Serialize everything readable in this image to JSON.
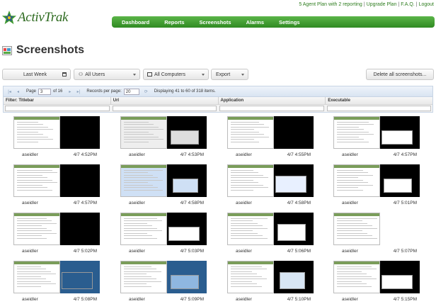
{
  "top_links": {
    "agent_plan": "5 Agent Plan with 2 reporting",
    "upgrade": "Upgrade Plan",
    "faq": "F.A.Q.",
    "logout": "Logout"
  },
  "brand": {
    "name": "ActivTrak",
    "accent": "#3f9b2e",
    "text_color": "#2d6a1f"
  },
  "nav": [
    "Dashboard",
    "Reports",
    "Screenshots",
    "Alarms",
    "Settings"
  ],
  "page": {
    "title": "Screenshots"
  },
  "toolbar": {
    "period": "Last Week",
    "users": "All Users",
    "computers": "All Computers",
    "export": "Export",
    "delete_all": "Delete all screenshots..."
  },
  "pager": {
    "page_label": "Page",
    "page": "3",
    "of": "of 16",
    "records_label": "Records per page:",
    "records": "20",
    "displaying": "Displaying 41 to 60 of 318 items."
  },
  "filters": [
    "Filter: Titlebar",
    "Url",
    "Application",
    "Executable"
  ],
  "screenshots": [
    {
      "user": "aseidler",
      "time": "4/7 4:52PM"
    },
    {
      "user": "aseidler",
      "time": "4/7 4:53PM"
    },
    {
      "user": "aseidler",
      "time": "4/7 4:55PM"
    },
    {
      "user": "aseidler",
      "time": "4/7 4:57PM"
    },
    {
      "user": "aseidler",
      "time": "4/7 4:57PM"
    },
    {
      "user": "aseidler",
      "time": "4/7 4:58PM"
    },
    {
      "user": "aseidler",
      "time": "4/7 4:58PM"
    },
    {
      "user": "aseidler",
      "time": "4/7 5:01PM"
    },
    {
      "user": "aseidler",
      "time": "4/7 5:02PM"
    },
    {
      "user": "aseidler",
      "time": "4/7 5:03PM"
    },
    {
      "user": "aseidler",
      "time": "4/7 5:06PM"
    },
    {
      "user": "aseidler",
      "time": "4/7 5:07PM"
    },
    {
      "user": "aseidler",
      "time": "4/7 5:08PM"
    },
    {
      "user": "aseidler",
      "time": "4/7 5:09PM"
    },
    {
      "user": "aseidler",
      "time": "4/7 5:10PM"
    },
    {
      "user": "aseidler",
      "time": "4/7 5:15PM"
    }
  ]
}
